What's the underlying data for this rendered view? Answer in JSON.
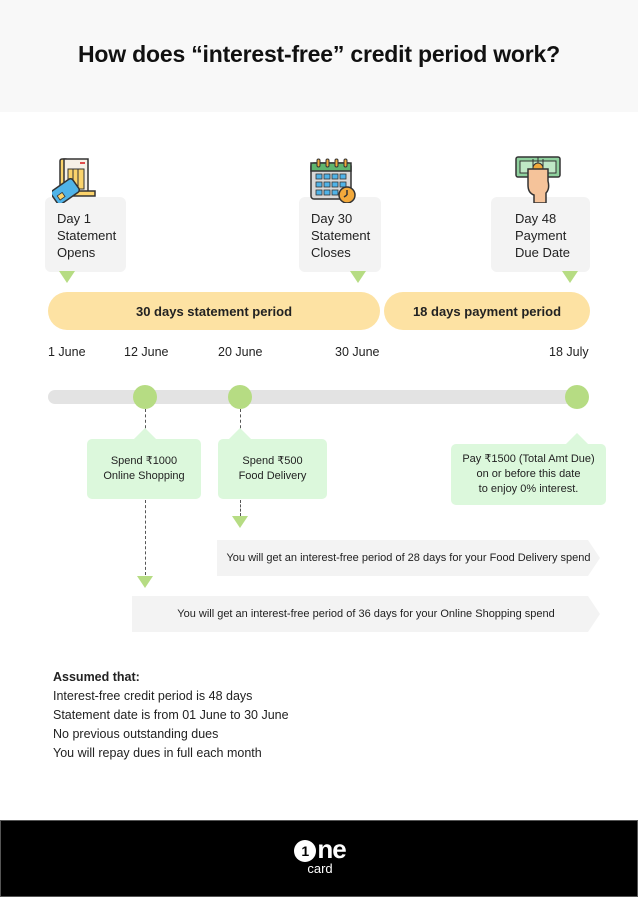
{
  "title": "How does “interest-free” credit period work?",
  "milestones": [
    {
      "icon": "bill-and-credit-card-icon",
      "text": "Day 1\nStatement\nOpens"
    },
    {
      "icon": "calendar-clock-icon",
      "text": "Day 30\nStatement\nCloses"
    },
    {
      "icon": "hand-holding-cash-icon",
      "text": "Day 48\nPayment\nDue Date"
    }
  ],
  "periods": [
    {
      "label": "30 days statement period",
      "days": 30
    },
    {
      "label": "18 days payment period",
      "days": 18
    }
  ],
  "dates": [
    "1 June",
    "12 June",
    "20 June",
    "30 June",
    "18 July"
  ],
  "timeline_events": [
    {
      "date": "12 June",
      "text": "Spend ₹1000\nOnline Shopping"
    },
    {
      "date": "20 June",
      "text": "Spend ₹500\nFood Delivery"
    },
    {
      "date": "18 July",
      "text": "Pay ₹1500 (Total Amt Due)\non or before this date\nto enjoy 0% interest."
    }
  ],
  "results": [
    {
      "text": "You will get an interest-free period of 28 days for your Food Delivery spend",
      "days": 28
    },
    {
      "text": "You will get an interest-free period of 36 days for your Online Shopping spend",
      "days": 36
    }
  ],
  "assumptions": {
    "heading": "Assumed that:",
    "items": [
      "Interest-free credit period is 48 days",
      "Statement date is from 01 June to 30 June",
      "No previous outstanding dues",
      "You will repay dues in full each month"
    ]
  },
  "footer": {
    "logo_mark": "1",
    "logo_word": "ne",
    "logo_sub": "card"
  },
  "colors": {
    "accent_green": "#b6dc83",
    "card_green": "#dcf8dc",
    "period_yellow": "#fde2a3",
    "footer_bg": "#000000"
  }
}
